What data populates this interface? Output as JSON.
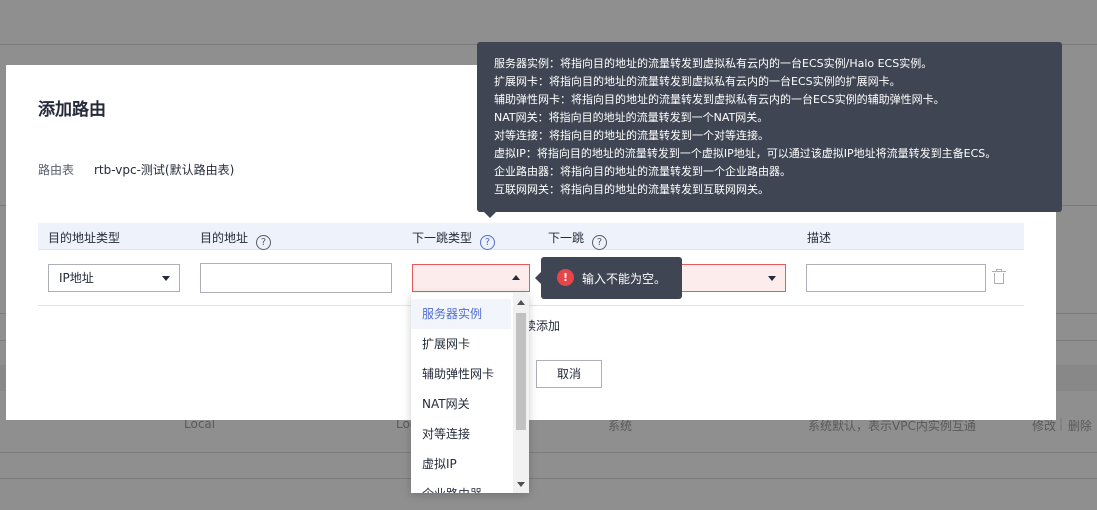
{
  "background": {
    "row": {
      "col1": "Local",
      "col2": "Loc",
      "col3": "系统",
      "col4": "系统默认，表示VPC内实例互通",
      "modify": "修改",
      "separator": "|",
      "delete": "删除"
    }
  },
  "modal": {
    "title": "添加路由",
    "route_table_label": "路由表",
    "route_table_value": "rtb-vpc-测试(默认路由表)",
    "columns": {
      "dest_type": "目的地址类型",
      "dest": "目的地址",
      "next_hop_type": "下一跳类型",
      "next_hop": "下一跳",
      "description": "描述"
    },
    "row": {
      "dest_type_value": "IP地址",
      "dest_value": "",
      "next_hop_type_value": "",
      "next_hop_value": "",
      "description_value": ""
    },
    "continue_add": "继续添加",
    "continue_add_visible": "续添加",
    "cancel": "取消"
  },
  "dropdown": {
    "items": [
      "服务器实例",
      "扩展网卡",
      "辅助弹性网卡",
      "NAT网关",
      "对等连接",
      "虚拟IP",
      "企业路由器"
    ],
    "selected_index": 0
  },
  "error_tooltip": {
    "icon": "!",
    "message": "输入不能为空。"
  },
  "info_tooltip": {
    "lines": [
      "服务器实例：将指向目的地址的流量转发到虚拟私有云内的一台ECS实例/Halo ECS实例。",
      "扩展网卡：将指向目的地址的流量转发到虚拟私有云内的一台ECS实例的扩展网卡。",
      "辅助弹性网卡：将指向目的地址的流量转发到虚拟私有云内的一台ECS实例的辅助弹性网卡。",
      "NAT网关：将指向目的地址的流量转发到一个NAT网关。",
      "对等连接：将指向目的地址的流量转发到一个对等连接。",
      "虚拟IP：将指向目的地址的流量转发到一个虚拟IP地址，可以通过该虚拟IP地址将流量转发到主备ECS。",
      "企业路由器：将指向目的地址的流量转发到一个企业路由器。",
      "互联网网关：将指向目的地址的流量转发到互联网网关。"
    ]
  },
  "colors": {
    "accent": "#526ecc",
    "error": "#e6454a",
    "tooltip_bg": "#3f4552",
    "overlay": "#8f8f8f"
  }
}
